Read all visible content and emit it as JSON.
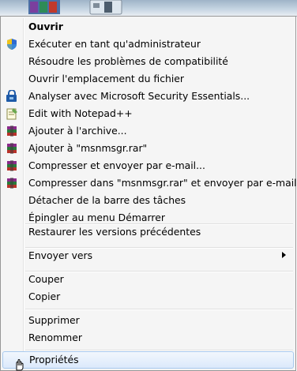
{
  "menu": {
    "items": [
      {
        "label": "Ouvrir",
        "bold": true,
        "icon": ""
      },
      {
        "label": "Exécuter en tant qu'administrateur",
        "icon": "uac-shield-icon"
      },
      {
        "label": "Résoudre les problèmes de compatibilité",
        "icon": ""
      },
      {
        "label": "Ouvrir l'emplacement du fichier",
        "icon": ""
      },
      {
        "label": "Analyser avec Microsoft Security Essentials...",
        "icon": "security-essentials-icon"
      },
      {
        "label": "Edit with Notepad++",
        "icon": "notepad-plus-plus-icon"
      },
      {
        "label": "Ajouter à l'archive...",
        "icon": "winrar-icon"
      },
      {
        "label": "Ajouter à \"msnmsgr.rar\"",
        "icon": "winrar-icon"
      },
      {
        "label": "Compresser et envoyer par e-mail...",
        "icon": "winrar-icon"
      },
      {
        "label": "Compresser dans \"msnmsgr.rar\" et envoyer par e-mail",
        "icon": "winrar-icon"
      },
      {
        "label": "Détacher de la barre des tâches",
        "icon": ""
      },
      {
        "label": "Épingler au menu Démarrer",
        "icon": ""
      },
      {
        "label": "Restaurer les versions précédentes",
        "icon": ""
      },
      {
        "label": "Envoyer vers",
        "icon": "",
        "submenu": true
      },
      {
        "label": "Couper",
        "icon": ""
      },
      {
        "label": "Copier",
        "icon": ""
      },
      {
        "label": "Supprimer",
        "icon": ""
      },
      {
        "label": "Renommer",
        "icon": ""
      },
      {
        "label": "Propriétés",
        "icon": "",
        "highlighted": true
      }
    ]
  },
  "colors": {
    "menu_background": "#f5f5f5",
    "menu_border": "#979797",
    "highlight_border": "#a8c9ee",
    "winrar_purple": "#8a2a8a",
    "shield_blue": "#2f6bd1"
  }
}
